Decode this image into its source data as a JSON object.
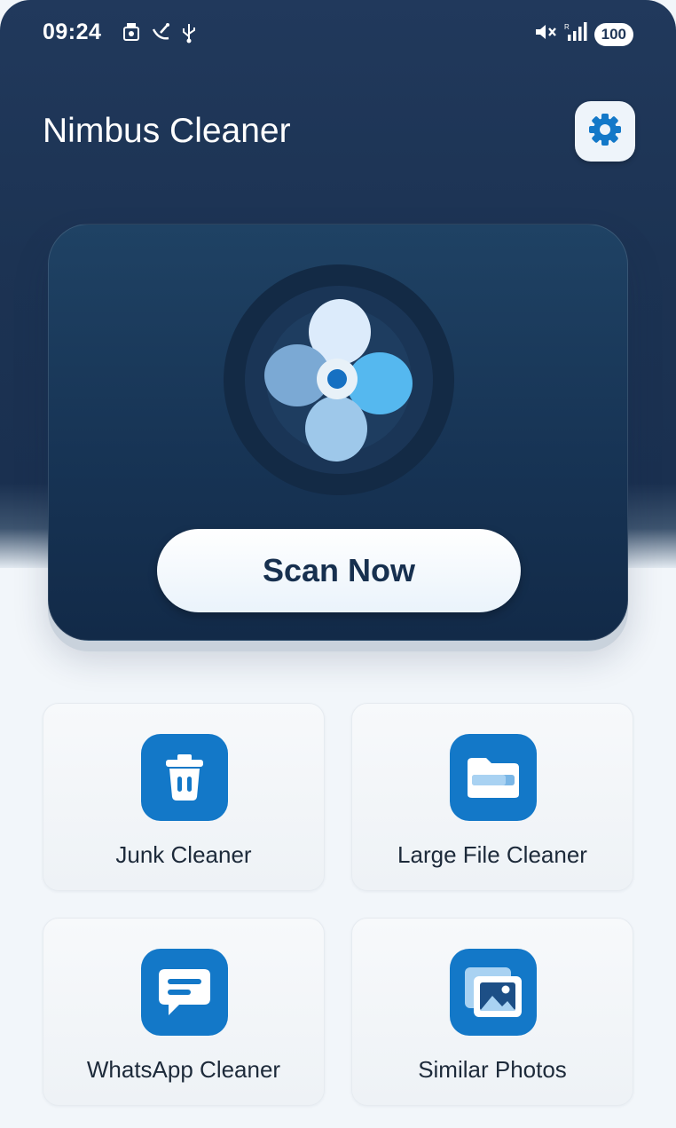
{
  "status_bar": {
    "time": "09:24",
    "battery": "100",
    "left_icons": [
      "photo-notification-icon",
      "satellite-icon",
      "usb-icon"
    ],
    "right_icons": [
      "mute-icon",
      "signal-icon",
      "battery-icon"
    ]
  },
  "header": {
    "title": "Nimbus Cleaner",
    "settings_icon": "gear-icon"
  },
  "hero": {
    "fan_icon": "fan-icon",
    "scan_button": "Scan Now"
  },
  "tools": [
    {
      "label": "Junk Cleaner",
      "icon": "trash-icon"
    },
    {
      "label": "Large File Cleaner",
      "icon": "folder-icon"
    },
    {
      "label": "WhatsApp Cleaner",
      "icon": "chat-icon"
    },
    {
      "label": "Similar Photos",
      "icon": "photos-icon"
    }
  ],
  "colors": {
    "header_bg": "#1c3353",
    "accent": "#1378c8",
    "page_bg": "#f2f6fa"
  }
}
